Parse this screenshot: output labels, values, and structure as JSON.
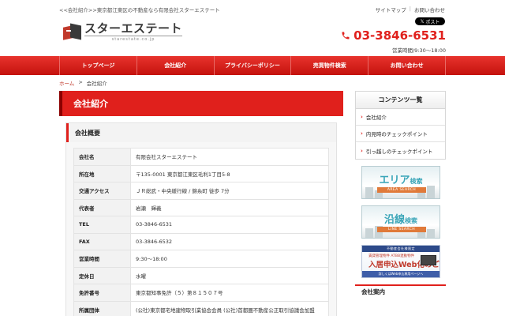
{
  "header": {
    "tagline": "<<会社紹介>>東京都江東区の不動産なら有限会社スターエステート",
    "links": [
      "サイトマップ",
      "お問い合わせ"
    ],
    "post_label": "ポスト",
    "logo_name": "スターエステート",
    "logo_sub": "starestate.co.jp",
    "phone": "03-3846-6531",
    "hours": "営業時間/9:30～18:00",
    "accent_color": "#e0201c"
  },
  "nav": {
    "items": [
      "トップページ",
      "会社紹介",
      "プライバシーポリシー",
      "売買物件検索",
      "お問い合わせ"
    ]
  },
  "breadcrumb": {
    "home": "ホーム",
    "sep": ">",
    "current": "会社紹介"
  },
  "main": {
    "title": "会社紹介",
    "section_title": "会社概要",
    "rows": [
      {
        "k": "会社名",
        "v": "有限会社スターエステート"
      },
      {
        "k": "所在地",
        "v": "〒135-0001 東京都江東区毛利1丁目5-8"
      },
      {
        "k": "交通アクセス",
        "v": "ＪＲ総武・中央緩行線 / 錦糸町 徒歩 7分"
      },
      {
        "k": "代表者",
        "v": "岩瀬　輝義"
      },
      {
        "k": "TEL",
        "v": "03-3846-6531"
      },
      {
        "k": "FAX",
        "v": "03-3846-6532"
      },
      {
        "k": "営業時間",
        "v": "9:30～18:00"
      },
      {
        "k": "定休日",
        "v": "水曜"
      },
      {
        "k": "免許番号",
        "v": "東京都知事免許（５）第８１５０７号"
      },
      {
        "k": "所属団体",
        "v": "(公社)東京都宅地建物取引業協会会員 (公社)首都圏不動産公正取引協議会加盟"
      }
    ]
  },
  "sidebar": {
    "title": "コンテンツ一覧",
    "items": [
      "会社紹介",
      "内見時のチェックポイント",
      "引っ越しのチェックポイント"
    ],
    "area_banner": {
      "jp": "エリア",
      "suffix": "検索",
      "en": "AREA SEARCH"
    },
    "line_banner": {
      "jp": "沿線",
      "suffix": "検索",
      "en": "LINE SEARCH"
    },
    "promo": {
      "top": "不動産会社様限定",
      "line1": "賃貸管理物件 ATBB連動物件",
      "line2": "入居申込Web化のご案内",
      "bottom": "詳しくはWeb申込専用ページへ"
    },
    "company_title": "会社案内"
  }
}
